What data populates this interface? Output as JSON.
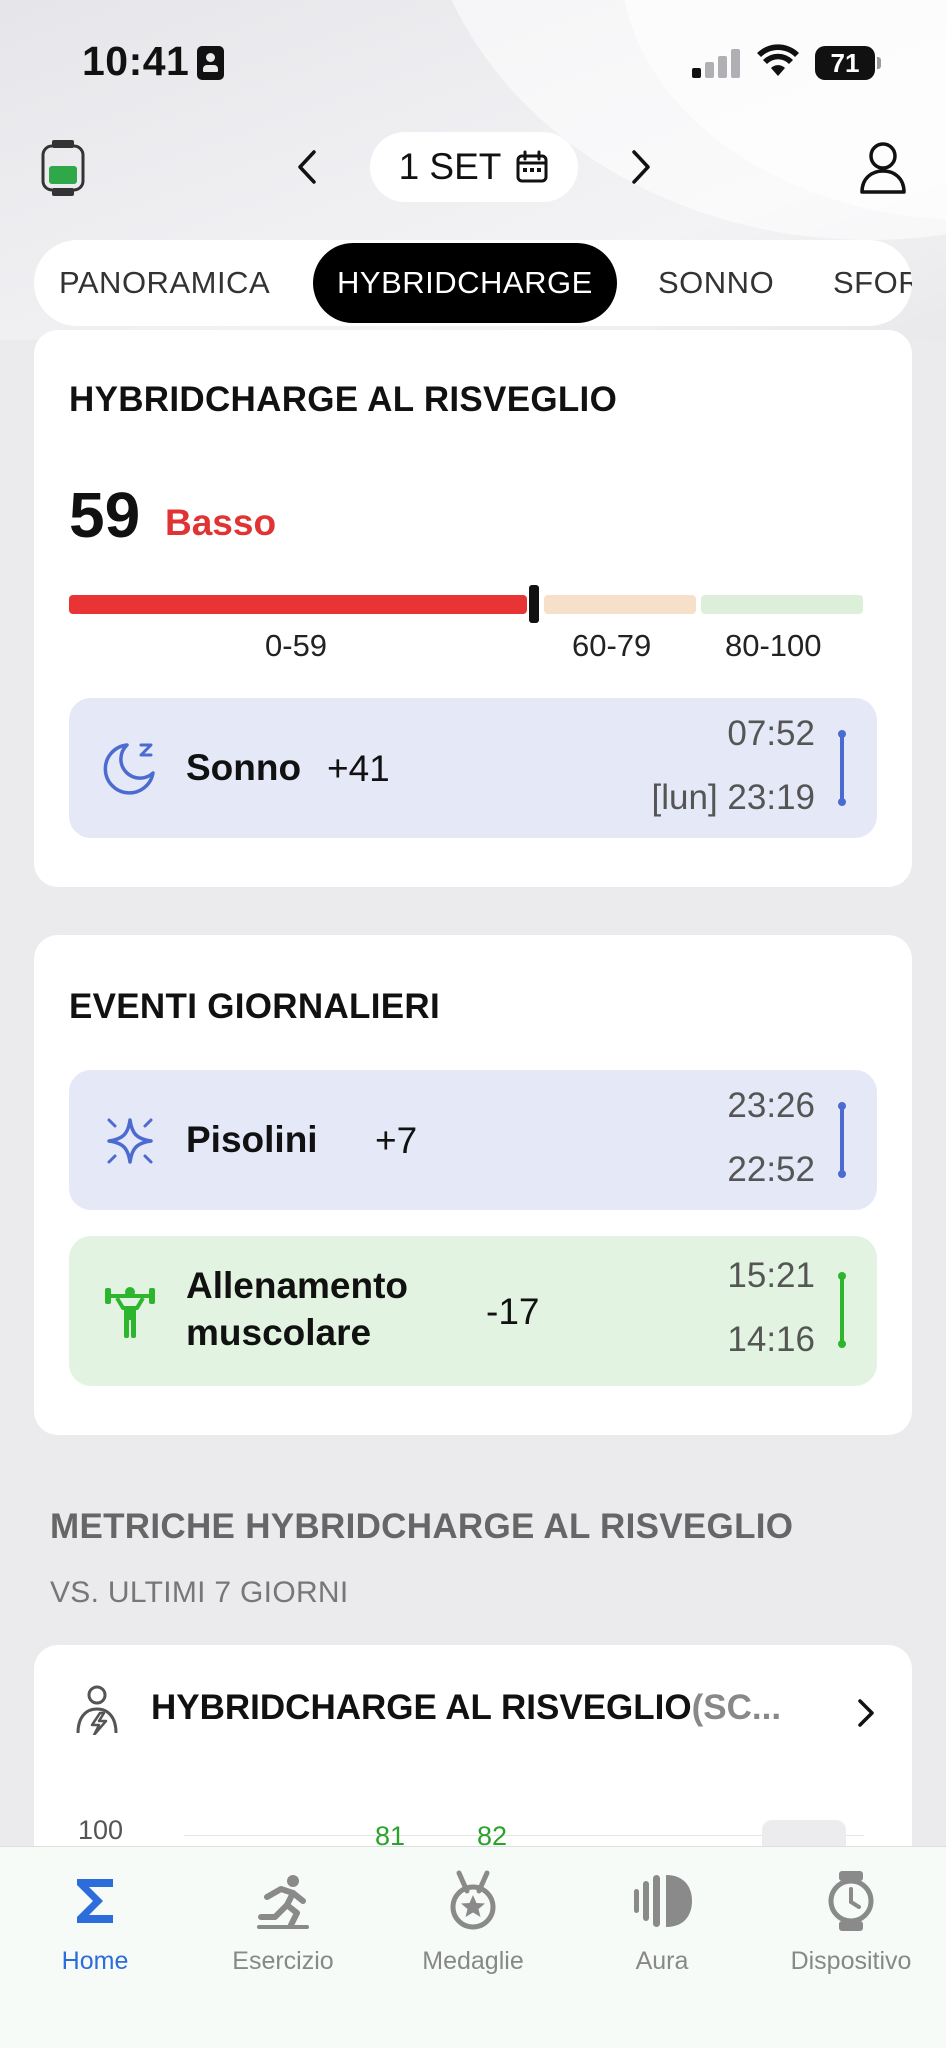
{
  "status_bar": {
    "time": "10:41",
    "battery": "71"
  },
  "header": {
    "date": "1 SET"
  },
  "tabs": [
    {
      "label": "PANORAMICA",
      "active": false
    },
    {
      "label": "HYBRIDCHARGE",
      "active": true
    },
    {
      "label": "SONNO",
      "active": false
    },
    {
      "label": "SFOR",
      "active": false
    }
  ],
  "wake_card": {
    "title": "HYBRIDCHARGE AL RISVEGLIO",
    "score": "59",
    "score_label": "Basso",
    "score_fraction": 0.59,
    "ranges": [
      "0-59",
      "60-79",
      "80-100"
    ],
    "colors": {
      "low": "#e83434",
      "mid": "#f7e0c9",
      "high": "#dcefd8"
    },
    "event": {
      "name": "Sonno",
      "delta": "+41",
      "time_end": "07:52",
      "time_start": "[lun] 23:19",
      "icon": "sleep-moon-icon"
    }
  },
  "daily_card": {
    "title": "EVENTI GIORNALIERI",
    "events": [
      {
        "name": "Pisolini",
        "delta": "+7",
        "time_end": "23:26",
        "time_start": "22:52",
        "icon": "nap-sparkle-icon",
        "color": "#4b6bd1"
      },
      {
        "name_line1": "Allenamento",
        "name_line2": "muscolare",
        "delta": "-17",
        "time_end": "15:21",
        "time_start": "14:16",
        "icon": "strength-training-icon",
        "color": "#2eb52e"
      }
    ]
  },
  "metrics_section": {
    "title": "METRICHE HYBRIDCHARGE AL RISVEGLIO",
    "subtitle": "VS. ULTIMI 7 GIORNI",
    "card_title": "HYBRIDCHARGE AL RISVEGLIO",
    "card_title_suffix": "(SC...",
    "axis_top": "100",
    "peek_values": [
      "81",
      "82"
    ]
  },
  "bottom_nav": [
    {
      "label": "Home",
      "icon": "sigma-home-icon",
      "active": true
    },
    {
      "label": "Esercizio",
      "icon": "running-icon",
      "active": false
    },
    {
      "label": "Medaglie",
      "icon": "medal-icon",
      "active": false
    },
    {
      "label": "Aura",
      "icon": "aura-icon",
      "active": false
    },
    {
      "label": "Dispositivo",
      "icon": "watch-device-icon",
      "active": false
    }
  ]
}
